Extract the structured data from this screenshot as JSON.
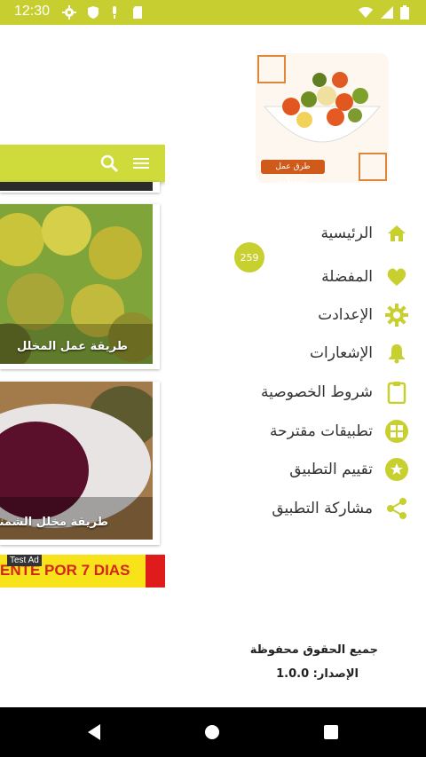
{
  "status_bar": {
    "time": "12:30"
  },
  "app": {
    "cards": [
      {
        "caption": "طريقة عمل المخلل"
      },
      {
        "caption": "طريقة مخلل الشمندر"
      }
    ],
    "ad": {
      "badge": "Test Ad",
      "text": "ENTE POR 7 DIAS"
    }
  },
  "drawer": {
    "logo_text": "طرق عمل المخللات",
    "menu": [
      {
        "label": "الرئيسية",
        "icon": "home-icon"
      },
      {
        "label": "المفضلة",
        "icon": "heart-icon"
      },
      {
        "label": "الإعدادت",
        "icon": "gear-icon"
      },
      {
        "label": "الإشعارات",
        "icon": "bell-icon"
      },
      {
        "label": "شروط الخصوصية",
        "icon": "clipboard-icon"
      },
      {
        "label": "تطبيقات مقترحة",
        "icon": "apps-icon"
      },
      {
        "label": "تقييم التطبيق",
        "icon": "star-icon"
      },
      {
        "label": "مشاركة التطبيق",
        "icon": "share-icon"
      }
    ],
    "home_badge": "259",
    "footer": {
      "rights": "جميع الحقوق محفوظة",
      "version": "الإصدار: 1.0.0"
    }
  },
  "colors": {
    "accent": "#c6cf2f",
    "icon": "#c8d030"
  }
}
